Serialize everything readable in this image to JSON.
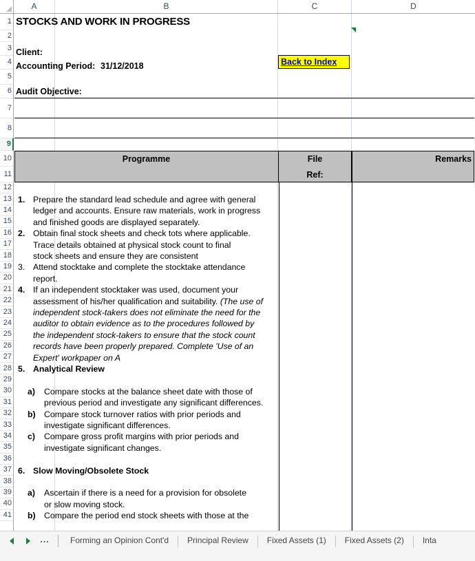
{
  "window": {
    "title": "STOCKS AND WORK IN PROGRESS"
  },
  "grid": {
    "column_headers": [
      "A",
      "B",
      "C",
      "D"
    ],
    "row_numbers": [
      1,
      2,
      3,
      4,
      5,
      6,
      7,
      8,
      9,
      10,
      11,
      12,
      13,
      14,
      15,
      16,
      17,
      18,
      19,
      20,
      21,
      22,
      23,
      24,
      25,
      26,
      27,
      28,
      29,
      30,
      31,
      32,
      33,
      34,
      35,
      36,
      37,
      38,
      39,
      40,
      41
    ],
    "selected_row": 9,
    "header_fill": "#c0c0c0",
    "selection_color": "#217346"
  },
  "sheet": {
    "title": "STOCKS AND WORK IN PROGRESS",
    "client_label": "Client:",
    "client_value": "",
    "accounting_period_label": "Accounting Period:",
    "accounting_period_value": "31/12/2018",
    "audit_objective_label": "Audit Objective:",
    "back_to_index": "Back to Index",
    "back_to_index_fill": "#ffff00",
    "back_to_index_color": "#0000c0"
  },
  "table": {
    "headers": {
      "programme": "Programme",
      "file": "File",
      "ref": "Ref:",
      "remarks": "Remarks"
    }
  },
  "programme": [
    {
      "num": "1.",
      "num_bold": true,
      "row": 13,
      "lines": [
        "Prepare the standard lead schedule and agree with general",
        "ledger and accounts. Ensure raw materials, work in progress",
        "and finished goods are displayed separately."
      ],
      "styles": [
        "normal",
        "normal",
        "normal"
      ]
    },
    {
      "num": "2.",
      "num_bold": true,
      "row": 16,
      "lines": [
        "Obtain final stock sheets and check tots where applicable.",
        "Trace details obtained at physical stock count to final",
        "stock sheets and ensure they are consistent"
      ],
      "styles": [
        "normal",
        "normal",
        "normal"
      ]
    },
    {
      "num": "3.",
      "num_bold": false,
      "row": 19,
      "lines": [
        "Attend stocktake and complete the stocktake attendance",
        "report."
      ],
      "styles": [
        "normal",
        "normal"
      ]
    },
    {
      "num": "4.",
      "num_bold": true,
      "row": 21,
      "lines": [
        "If an independent stocktaker was used, document your",
        "assessment of his/her qualification and suitability. (The use of",
        "independent stock-takers does not eliminate the need for the",
        "auditor to obtain evidence as to the procedures followed by",
        "the independent stock-takers to ensure that the stock count",
        "records have been properly prepared. Complete 'Use of an",
        "Expert' workpaper on A"
      ],
      "styles": [
        "normal",
        "mixed",
        "italic",
        "italic",
        "italic",
        "italic",
        "italic"
      ],
      "mixed_plain": "assessment of his/her qualification and suitability. ",
      "mixed_italic": "(The use of"
    },
    {
      "num": "5.",
      "num_bold": true,
      "row": 28,
      "lines": [
        "Analytical Review"
      ],
      "styles": [
        "bold"
      ]
    },
    {
      "num": "a)",
      "num_bold": true,
      "row": 30,
      "indent": true,
      "lines": [
        "Compare stocks at the balance sheet date with those of",
        "previous period and investigate any significant differences."
      ],
      "styles": [
        "normal",
        "normal"
      ]
    },
    {
      "num": "b)",
      "num_bold": true,
      "row": 32,
      "indent": true,
      "lines": [
        "Compare stock turnover ratios with prior periods and",
        "investigate significant differences."
      ],
      "styles": [
        "normal",
        "normal"
      ]
    },
    {
      "num": "c)",
      "num_bold": true,
      "row": 34,
      "indent": true,
      "lines": [
        "Compare gross profit margins with prior periods and",
        "investigate significant changes."
      ],
      "styles": [
        "normal",
        "normal"
      ]
    },
    {
      "num": "6.",
      "num_bold": true,
      "row": 37,
      "lines": [
        "Slow Moving/Obsolete Stock"
      ],
      "styles": [
        "bold"
      ]
    },
    {
      "num": "a)",
      "num_bold": true,
      "row": 39,
      "indent": true,
      "lines": [
        "Ascertain if there is a need for a provision for obsolete",
        "or slow moving stock."
      ],
      "styles": [
        "normal",
        "normal"
      ]
    },
    {
      "num": "b)",
      "num_bold": true,
      "row": 41,
      "indent": true,
      "lines": [
        "Compare the period end stock sheets with those at the"
      ],
      "styles": [
        "normal"
      ]
    }
  ],
  "tabbar": {
    "prev_label": "previous-sheet",
    "next_label": "next-sheet",
    "ellipsis": "...",
    "tabs": [
      {
        "label": "Forming an Opinion Cont'd",
        "active": false
      },
      {
        "label": "Principal Review",
        "active": false
      },
      {
        "label": "Fixed Assets (1)",
        "active": false
      },
      {
        "label": "Fixed Assets (2)",
        "active": false
      },
      {
        "label": "Inta",
        "active": false
      }
    ]
  }
}
